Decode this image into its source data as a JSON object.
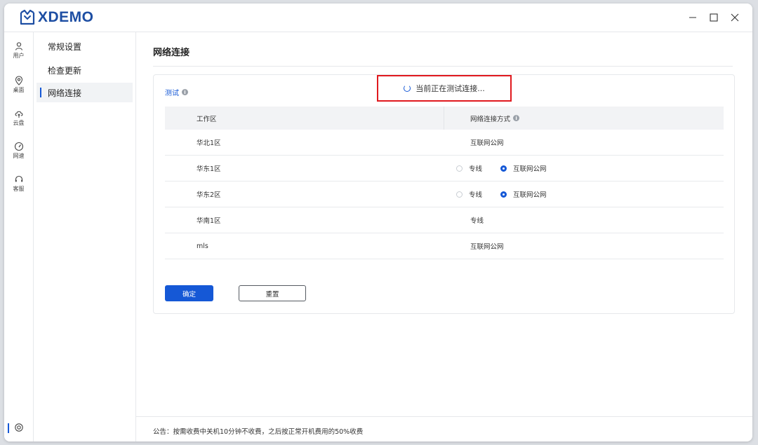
{
  "app": {
    "logo_text": "XDEMO"
  },
  "window_controls": [
    "minimize-icon",
    "maximize-icon",
    "close-icon"
  ],
  "rail": {
    "items": [
      {
        "label": "用户",
        "icon": "user-icon"
      },
      {
        "label": "桌面",
        "icon": "location-icon"
      },
      {
        "label": "云盘",
        "icon": "cloud-icon"
      },
      {
        "label": "网速",
        "icon": "speedometer-icon"
      },
      {
        "label": "客服",
        "icon": "headset-icon"
      }
    ],
    "settings_icon": "settings-icon"
  },
  "submenu": {
    "items": [
      {
        "label": "常规设置",
        "active": false
      },
      {
        "label": "检查更新",
        "active": false
      },
      {
        "label": "网络连接",
        "active": true
      }
    ]
  },
  "page": {
    "title": "网络连接"
  },
  "card": {
    "label": "测试",
    "status_text": "当前正在测试连接..."
  },
  "table": {
    "headers": {
      "zone": "工作区",
      "method": "网络连接方式"
    },
    "rows": [
      {
        "zone": "华北1区",
        "method": "互联网公网"
      },
      {
        "zone": "华东1区",
        "options": [
          "专线",
          "互联网公网"
        ],
        "selected": "互联网公网"
      },
      {
        "zone": "华东2区",
        "options": [
          "专线",
          "互联网公网"
        ],
        "selected": "互联网公网"
      },
      {
        "zone": "华南1区",
        "method": "专线"
      },
      {
        "zone": "mls",
        "method": "互联网公网"
      }
    ]
  },
  "buttons": {
    "confirm": "确定",
    "reset": "重置"
  },
  "footer": {
    "notice": "公告：按需收费中关机10分钟不收费，之后按正常开机费用的50%收费"
  },
  "colors": {
    "accent": "#1558d6",
    "highlight_border": "#e0191e",
    "logo": "#1d4ea3"
  }
}
